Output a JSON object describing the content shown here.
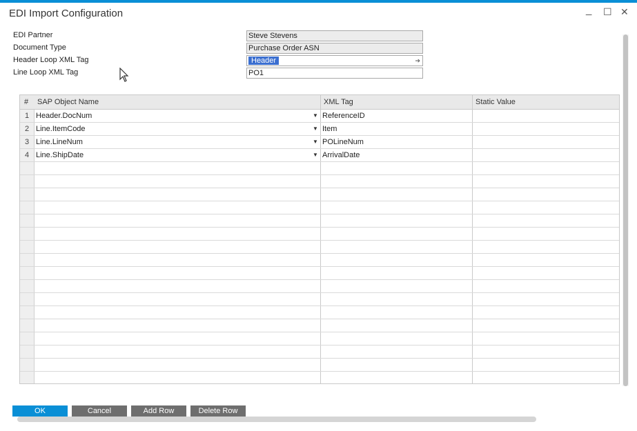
{
  "window": {
    "title": "EDI Import Configuration",
    "minimize_glyph": "_",
    "maximize_glyph": "☐",
    "close_glyph": "✕"
  },
  "fields": {
    "edi_partner": {
      "label": "EDI Partner",
      "value": "Steve Stevens"
    },
    "document_type": {
      "label": "Document Type",
      "value": "Purchase Order ASN"
    },
    "header_loop": {
      "label": "Header Loop XML Tag",
      "value": "Header"
    },
    "line_loop": {
      "label": "Line Loop XML Tag",
      "value": "PO1"
    }
  },
  "grid": {
    "columns": {
      "num": "#",
      "sap_object": "SAP Object Name",
      "xml_tag": "XML Tag",
      "static_value": "Static Value"
    },
    "rows": [
      {
        "num": "1",
        "sap": "Header.DocNum",
        "xml": "ReferenceID",
        "static": ""
      },
      {
        "num": "2",
        "sap": "Line.ItemCode",
        "xml": "Item",
        "static": ""
      },
      {
        "num": "3",
        "sap": "Line.LineNum",
        "xml": "POLineNum",
        "static": ""
      },
      {
        "num": "4",
        "sap": "Line.ShipDate",
        "xml": "ArrivalDate",
        "static": ""
      }
    ]
  },
  "buttons": {
    "ok": "OK",
    "cancel": "Cancel",
    "add_row": "Add Row",
    "delete_row": "Delete Row"
  },
  "colors": {
    "accent": "#0a8fd6",
    "selection": "#3b6fd0",
    "button_grey": "#6e6e6e"
  },
  "icons": {
    "link_arrow": "link-arrow-icon",
    "dropdown": "dropdown-arrow-icon",
    "cursor": "mouse-cursor-icon"
  }
}
